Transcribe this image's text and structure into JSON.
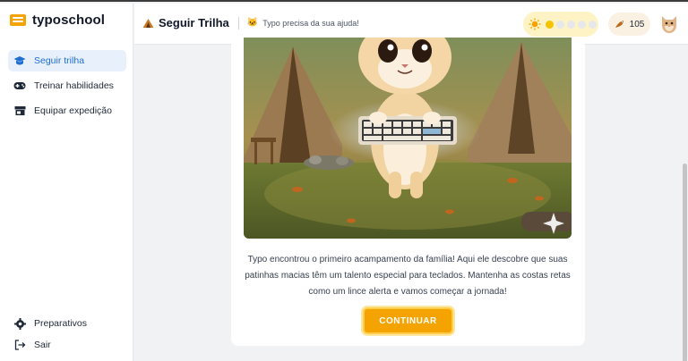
{
  "brand": {
    "name": "typoschool"
  },
  "sidebar": {
    "items": [
      {
        "label": "Seguir trilha",
        "icon": "graduation-cap-icon",
        "active": true
      },
      {
        "label": "Treinar habilidades",
        "icon": "gamepad-icon",
        "active": false
      },
      {
        "label": "Equipar expedição",
        "icon": "store-icon",
        "active": false
      }
    ],
    "bottom": [
      {
        "label": "Preparativos",
        "icon": "gear-icon"
      },
      {
        "label": "Sair",
        "icon": "logout-icon"
      }
    ]
  },
  "header": {
    "title": "Seguir Trilha",
    "subtitle": "Typo precisa da sua ajuda!",
    "progress": {
      "filled": 1,
      "total": 5
    },
    "coins": "105"
  },
  "lesson": {
    "story": "Typo encontrou o primeiro acampamento da família! Aqui ele descobre que suas patinhas macias têm um talento especial para teclados. Mantenha as costas retas como um lince alerta e vamos começar a jornada!",
    "button_label": "CONTINUAR"
  },
  "colors": {
    "accent": "#f5a300",
    "active_nav": "#1f6fd1",
    "active_nav_bg": "#e8f0fb",
    "progress_bg": "#fdf3c4",
    "progress_on": "#f5c400"
  }
}
